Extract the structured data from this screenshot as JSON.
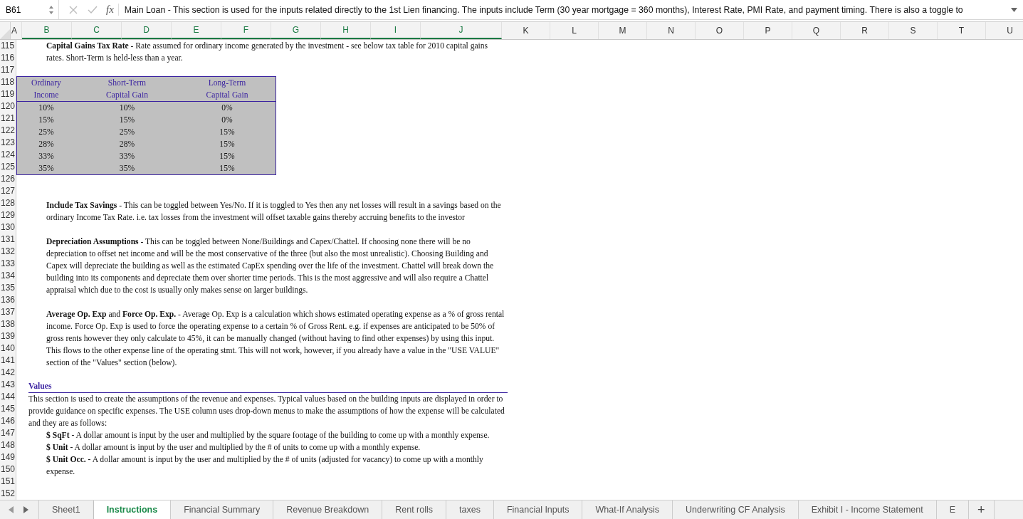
{
  "formula_bar": {
    "cell_ref": "B61",
    "fx": "fx",
    "content": "Main Loan - This section is used for the inputs related directly to the 1st Lien financing.  The inputs include Term (30 year mortgage = 360 months), Interest Rate, PMI Rate, and payment timing.  There is also a toggle to"
  },
  "columns": [
    {
      "label": "A",
      "selected": false
    },
    {
      "label": "B",
      "selected": true
    },
    {
      "label": "C",
      "selected": true
    },
    {
      "label": "D",
      "selected": true
    },
    {
      "label": "E",
      "selected": true
    },
    {
      "label": "F",
      "selected": true
    },
    {
      "label": "G",
      "selected": true
    },
    {
      "label": "H",
      "selected": true
    },
    {
      "label": "I",
      "selected": true
    },
    {
      "label": "J",
      "selected": true
    },
    {
      "label": "K",
      "selected": false
    },
    {
      "label": "L",
      "selected": false
    },
    {
      "label": "M",
      "selected": false
    },
    {
      "label": "N",
      "selected": false
    },
    {
      "label": "O",
      "selected": false
    },
    {
      "label": "P",
      "selected": false
    },
    {
      "label": "Q",
      "selected": false
    },
    {
      "label": "R",
      "selected": false
    },
    {
      "label": "S",
      "selected": false
    },
    {
      "label": "T",
      "selected": false
    },
    {
      "label": "U",
      "selected": false
    }
  ],
  "row_numbers": [
    "115",
    "116",
    "117",
    "118",
    "119",
    "120",
    "121",
    "122",
    "123",
    "124",
    "125",
    "126",
    "127",
    "128",
    "129",
    "130",
    "131",
    "132",
    "133",
    "134",
    "135",
    "136",
    "137",
    "138",
    "139",
    "140",
    "141",
    "142",
    "143",
    "144",
    "145",
    "146",
    "147",
    "148",
    "149",
    "150",
    "151",
    "152"
  ],
  "blocks": [
    {
      "kind": "note",
      "text": "**Capital Gains Tax Rate**  - Rate assumed for ordinary income generated by the investment - see below tax table for 2010 capital gains rates.  Short-Term is held-less than a year."
    },
    {
      "kind": "table",
      "headers": [
        [
          "Ordinary",
          "Income"
        ],
        [
          "Short-Term",
          "Capital Gain"
        ],
        [
          "Long-Term",
          "Capital Gain"
        ]
      ],
      "rows": [
        [
          "10%",
          "10%",
          "0%"
        ],
        [
          "15%",
          "15%",
          "0%"
        ],
        [
          "25%",
          "25%",
          "15%"
        ],
        [
          "28%",
          "28%",
          "15%"
        ],
        [
          "33%",
          "33%",
          "15%"
        ],
        [
          "35%",
          "35%",
          "15%"
        ]
      ]
    },
    {
      "kind": "note",
      "text": "**Include Tax Savings**  - This can be toggled between Yes/No.  If it is toggled to Yes then any net losses will result in a savings based on the ordinary Income Tax Rate. i.e. tax losses from the investment will offset taxable gains thereby accruing benefits to the investor"
    },
    {
      "kind": "note",
      "text": "**Depreciation Assumptions**  - This can be toggled between None/Buildings and Capex/Chattel.  If choosing none there will be no depreciation to offset net income and will be the most conservative of the three (but also the most unrealistic).  Choosing Building and Capex will depreciate the building as well as the estimated CapEx spending over the life of the investment. Chattel will break down the building into its components and depreciate them over shorter time periods.  This is the most aggressive and will also require a Chattel appraisal which due to the cost is usually only makes sense on larger buildings."
    },
    {
      "kind": "note",
      "text": "**Average Op. Exp** and **Force Op. Exp.**  - Average Op. Exp is a calculation which shows estimated operating expense as a % of gross rental income.  Force Op. Exp is used to force the operating expense to a certain % of Gross Rent.  e.g. if expenses are anticipated to be 50% of gross rents however they only calculate to 45%, it can be manually changed (without having to find other expenses) by using this input. This flows to the other expense line of the operating stmt.  This will not work, however, if you already have a value in the \"USE VALUE\" section of the \"Values\" section (below)."
    },
    {
      "kind": "heading",
      "text": "Values"
    },
    {
      "kind": "text",
      "text": "This section is used to create the assumptions of the revenue and expenses.  Typical values based on the building inputs are displayed in order to provide guidance on specific expenses.  The USE column uses drop-down menus to make the assumptions of how the expense will be calculated and they are as follows:"
    },
    {
      "kind": "definition",
      "text": "**$ SqFt -** A dollar amount is input by the user and multiplied by the square footage of the building to come up with a monthly expense."
    },
    {
      "kind": "definition",
      "text": "**$ Unit -** A dollar amount is input by the user and multiplied by the # of units to come up with a monthly expense."
    },
    {
      "kind": "definition",
      "text": "**$ Unit Occ. -** A dollar amount is input by the user and multiplied by the # of units (adjusted for vacancy) to come up with a monthly expense."
    }
  ],
  "sheet_tabs": [
    {
      "label": "Sheet1",
      "selected": false
    },
    {
      "label": "Instructions",
      "selected": true
    },
    {
      "label": "Financial Summary",
      "selected": false
    },
    {
      "label": "Revenue Breakdown",
      "selected": false
    },
    {
      "label": "Rent rolls",
      "selected": false
    },
    {
      "label": "taxes",
      "selected": false
    },
    {
      "label": "Financial Inputs",
      "selected": false
    },
    {
      "label": "What-If Analysis",
      "selected": false
    },
    {
      "label": "Underwriting CF Analysis",
      "selected": false
    },
    {
      "label": "Exhibit I - Income Statement",
      "selected": false
    },
    {
      "label": "E",
      "selected": false
    }
  ],
  "add_sheet": "+"
}
